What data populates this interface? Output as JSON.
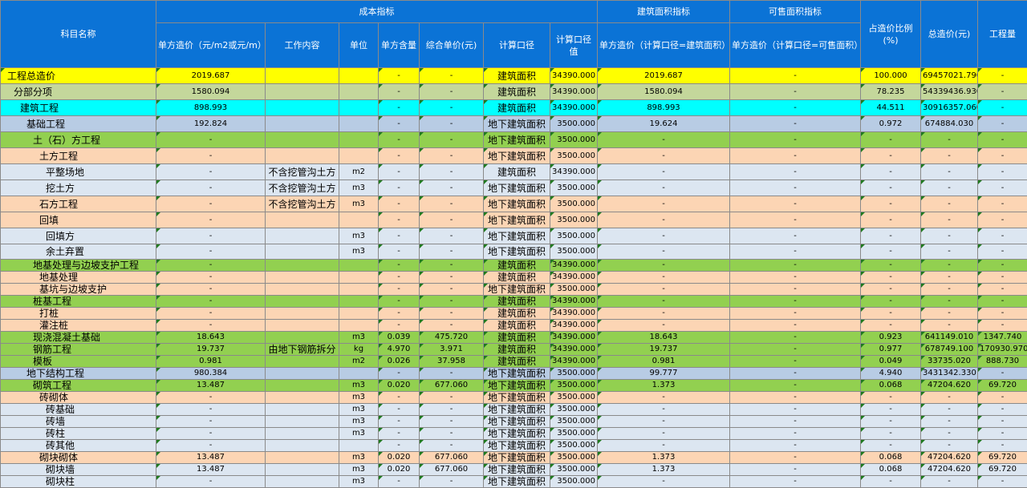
{
  "header": {
    "subject_name": "科目名称",
    "cost_indicator": "成本指标",
    "building_area_indicator": "建筑面积指标",
    "saleable_area_indicator": "可售面积指标",
    "cost_ratio": "占造价比例(%)",
    "total_cost": "总造价(元)",
    "quantity": "工程量",
    "unit_cost": "单方造价（元/m2或元/m）",
    "work_content": "工作内容",
    "unit": "单位",
    "unit_content": "单方含量",
    "composite_price": "综合单价(元)",
    "calc_basis": "计算口径",
    "calc_basis_value": "计算口径值",
    "unit_cost_building": "单方造价（计算口径=建筑面积）",
    "unit_cost_saleable": "单方造价（计算口径=可售面积）"
  },
  "colors": {
    "header_bg": "#0b73d6",
    "yellow": "#ffff00",
    "olive": "#c4d79b",
    "cyan": "#00ffff",
    "blue": "#b8cce4",
    "green": "#92d050",
    "peach": "#fcd5b4",
    "lavender": "#dce6f1"
  },
  "rows": [
    {
      "name": "工程总造价",
      "indent": 0,
      "color": "yellow",
      "h": 20,
      "unit_cost": "2019.687",
      "work": "",
      "unit": "",
      "content": "-",
      "price": "-",
      "basis": "建筑面积",
      "basis_val": "34390.000",
      "bldg": "2019.687",
      "sale": "-",
      "ratio": "100.000",
      "total": "69457021.790",
      "qty": "-"
    },
    {
      "name": "分部分项",
      "indent": 1,
      "color": "olive",
      "h": 20,
      "unit_cost": "1580.094",
      "work": "",
      "unit": "",
      "content": "-",
      "price": "-",
      "basis": "建筑面积",
      "basis_val": "34390.000",
      "bldg": "1580.094",
      "sale": "-",
      "ratio": "78.235",
      "total": "54339436.930",
      "qty": "-"
    },
    {
      "name": "建筑工程",
      "indent": 2,
      "color": "cyan",
      "h": 20,
      "unit_cost": "898.993",
      "work": "",
      "unit": "",
      "content": "-",
      "price": "-",
      "basis": "建筑面积",
      "basis_val": "34390.000",
      "bldg": "898.993",
      "sale": "-",
      "ratio": "44.511",
      "total": "30916357.060",
      "qty": "-"
    },
    {
      "name": "基础工程",
      "indent": 3,
      "color": "blue",
      "h": 20,
      "unit_cost": "192.824",
      "work": "",
      "unit": "",
      "content": "-",
      "price": "-",
      "basis": "地下建筑面积",
      "basis_val": "3500.000",
      "bldg": "19.624",
      "sale": "-",
      "ratio": "0.972",
      "total": "674884.030",
      "qty": "-"
    },
    {
      "name": "土（石）方工程",
      "indent": 4,
      "color": "green",
      "h": 20,
      "unit_cost": "-",
      "work": "",
      "unit": "",
      "content": "-",
      "price": "-",
      "basis": "地下建筑面积",
      "basis_val": "3500.000",
      "bldg": "-",
      "sale": "-",
      "ratio": "-",
      "total": "-",
      "qty": "-"
    },
    {
      "name": "土方工程",
      "indent": 5,
      "color": "peach",
      "h": 20,
      "unit_cost": "-",
      "work": "",
      "unit": "",
      "content": "-",
      "price": "-",
      "basis": "地下建筑面积",
      "basis_val": "3500.000",
      "bldg": "-",
      "sale": "-",
      "ratio": "-",
      "total": "-",
      "qty": "-"
    },
    {
      "name": "平整场地",
      "indent": 6,
      "color": "lav",
      "h": 20,
      "unit_cost": "-",
      "work": "不含挖管沟土方",
      "unit": "m2",
      "content": "-",
      "price": "-",
      "basis": "建筑面积",
      "basis_val": "34390.000",
      "bldg": "-",
      "sale": "-",
      "ratio": "-",
      "total": "-",
      "qty": "-"
    },
    {
      "name": "挖土方",
      "indent": 6,
      "color": "lav",
      "h": 20,
      "unit_cost": "-",
      "work": "不含挖管沟土方",
      "unit": "m3",
      "content": "-",
      "price": "-",
      "basis": "地下建筑面积",
      "basis_val": "3500.000",
      "bldg": "-",
      "sale": "-",
      "ratio": "-",
      "total": "-",
      "qty": "-"
    },
    {
      "name": "石方工程",
      "indent": 5,
      "color": "peach",
      "h": 20,
      "unit_cost": "-",
      "work": "不含挖管沟土方",
      "unit": "m3",
      "content": "-",
      "price": "-",
      "basis": "地下建筑面积",
      "basis_val": "3500.000",
      "bldg": "-",
      "sale": "-",
      "ratio": "-",
      "total": "-",
      "qty": "-"
    },
    {
      "name": "回填",
      "indent": 5,
      "color": "peach",
      "h": 20,
      "unit_cost": "-",
      "work": "",
      "unit": "",
      "content": "-",
      "price": "-",
      "basis": "地下建筑面积",
      "basis_val": "3500.000",
      "bldg": "-",
      "sale": "-",
      "ratio": "-",
      "total": "-",
      "qty": "-"
    },
    {
      "name": "回填方",
      "indent": 6,
      "color": "lav",
      "h": 20,
      "unit_cost": "-",
      "work": "",
      "unit": "m3",
      "content": "-",
      "price": "-",
      "basis": "地下建筑面积",
      "basis_val": "3500.000",
      "bldg": "-",
      "sale": "-",
      "ratio": "-",
      "total": "-",
      "qty": "-"
    },
    {
      "name": "余土弃置",
      "indent": 6,
      "color": "lav",
      "h": 19,
      "unit_cost": "-",
      "work": "",
      "unit": "m3",
      "content": "-",
      "price": "-",
      "basis": "地下建筑面积",
      "basis_val": "3500.000",
      "bldg": "-",
      "sale": "-",
      "ratio": "-",
      "total": "-",
      "qty": "-"
    },
    {
      "name": "地基处理与边坡支护工程",
      "indent": 4,
      "color": "green",
      "h": 15,
      "unit_cost": "-",
      "work": "",
      "unit": "",
      "content": "-",
      "price": "-",
      "basis": "建筑面积",
      "basis_val": "34390.000",
      "bldg": "-",
      "sale": "-",
      "ratio": "-",
      "total": "-",
      "qty": "-"
    },
    {
      "name": "地基处理",
      "indent": 5,
      "color": "peach",
      "h": 15,
      "unit_cost": "-",
      "work": "",
      "unit": "",
      "content": "-",
      "price": "-",
      "basis": "建筑面积",
      "basis_val": "34390.000",
      "bldg": "-",
      "sale": "-",
      "ratio": "-",
      "total": "-",
      "qty": "-"
    },
    {
      "name": "基坑与边坡支护",
      "indent": 5,
      "color": "peach",
      "h": 15,
      "unit_cost": "-",
      "work": "",
      "unit": "",
      "content": "-",
      "price": "-",
      "basis": "地下建筑面积",
      "basis_val": "3500.000",
      "bldg": "-",
      "sale": "-",
      "ratio": "-",
      "total": "-",
      "qty": "-"
    },
    {
      "name": "桩基工程",
      "indent": 4,
      "color": "green",
      "h": 15,
      "unit_cost": "-",
      "work": "",
      "unit": "",
      "content": "-",
      "price": "-",
      "basis": "建筑面积",
      "basis_val": "34390.000",
      "bldg": "-",
      "sale": "-",
      "ratio": "-",
      "total": "-",
      "qty": "-"
    },
    {
      "name": "打桩",
      "indent": 5,
      "color": "peach",
      "h": 15,
      "unit_cost": "-",
      "work": "",
      "unit": "",
      "content": "-",
      "price": "-",
      "basis": "建筑面积",
      "basis_val": "34390.000",
      "bldg": "-",
      "sale": "-",
      "ratio": "-",
      "total": "-",
      "qty": "-"
    },
    {
      "name": "灌注桩",
      "indent": 5,
      "color": "peach",
      "h": 15,
      "unit_cost": "-",
      "work": "",
      "unit": "",
      "content": "-",
      "price": "-",
      "basis": "建筑面积",
      "basis_val": "34390.000",
      "bldg": "-",
      "sale": "-",
      "ratio": "-",
      "total": "-",
      "qty": "-"
    },
    {
      "name": "现浇混凝土基础",
      "indent": 4,
      "color": "green",
      "h": 15,
      "unit_cost": "18.643",
      "work": "",
      "unit": "m3",
      "content": "0.039",
      "price": "475.720",
      "basis": "建筑面积",
      "basis_val": "34390.000",
      "bldg": "18.643",
      "sale": "-",
      "ratio": "0.923",
      "total": "641149.010",
      "qty": "1347.740"
    },
    {
      "name": "钢筋工程",
      "indent": 4,
      "color": "green",
      "h": 15,
      "unit_cost": "19.737",
      "work": "由地下钢筋拆分",
      "unit": "kg",
      "content": "4.970",
      "price": "3.971",
      "basis": "建筑面积",
      "basis_val": "34390.000",
      "bldg": "19.737",
      "sale": "-",
      "ratio": "0.977",
      "total": "678749.100",
      "qty": "170930.970"
    },
    {
      "name": "模板",
      "indent": 4,
      "color": "green",
      "h": 15,
      "unit_cost": "0.981",
      "work": "",
      "unit": "m2",
      "content": "0.026",
      "price": "37.958",
      "basis": "建筑面积",
      "basis_val": "34390.000",
      "bldg": "0.981",
      "sale": "-",
      "ratio": "0.049",
      "total": "33735.020",
      "qty": "888.730"
    },
    {
      "name": "地下结构工程",
      "indent": 3,
      "color": "blue",
      "h": 15,
      "unit_cost": "980.384",
      "work": "",
      "unit": "",
      "content": "-",
      "price": "-",
      "basis": "地下建筑面积",
      "basis_val": "3500.000",
      "bldg": "99.777",
      "sale": "-",
      "ratio": "4.940",
      "total": "3431342.330",
      "qty": "-"
    },
    {
      "name": "砌筑工程",
      "indent": 4,
      "color": "green",
      "h": 15,
      "unit_cost": "13.487",
      "work": "",
      "unit": "m3",
      "content": "0.020",
      "price": "677.060",
      "basis": "地下建筑面积",
      "basis_val": "3500.000",
      "bldg": "1.373",
      "sale": "-",
      "ratio": "0.068",
      "total": "47204.620",
      "qty": "69.720"
    },
    {
      "name": "砖砌体",
      "indent": 5,
      "color": "peach",
      "h": 15,
      "unit_cost": "-",
      "work": "",
      "unit": "m3",
      "content": "-",
      "price": "-",
      "basis": "地下建筑面积",
      "basis_val": "3500.000",
      "bldg": "-",
      "sale": "-",
      "ratio": "-",
      "total": "-",
      "qty": "-"
    },
    {
      "name": "砖基础",
      "indent": 6,
      "color": "lav",
      "h": 15,
      "unit_cost": "-",
      "work": "",
      "unit": "m3",
      "content": "-",
      "price": "-",
      "basis": "地下建筑面积",
      "basis_val": "3500.000",
      "bldg": "-",
      "sale": "-",
      "ratio": "-",
      "total": "-",
      "qty": "-"
    },
    {
      "name": "砖墙",
      "indent": 6,
      "color": "lav",
      "h": 15,
      "unit_cost": "-",
      "work": "",
      "unit": "m3",
      "content": "-",
      "price": "-",
      "basis": "地下建筑面积",
      "basis_val": "3500.000",
      "bldg": "-",
      "sale": "-",
      "ratio": "-",
      "total": "-",
      "qty": "-"
    },
    {
      "name": "砖柱",
      "indent": 6,
      "color": "lav",
      "h": 15,
      "unit_cost": "-",
      "work": "",
      "unit": "m3",
      "content": "-",
      "price": "-",
      "basis": "地下建筑面积",
      "basis_val": "3500.000",
      "bldg": "-",
      "sale": "-",
      "ratio": "-",
      "total": "-",
      "qty": "-"
    },
    {
      "name": "砖其他",
      "indent": 6,
      "color": "lav",
      "h": 15,
      "unit_cost": "-",
      "work": "",
      "unit": "",
      "content": "-",
      "price": "-",
      "basis": "地下建筑面积",
      "basis_val": "3500.000",
      "bldg": "-",
      "sale": "-",
      "ratio": "-",
      "total": "-",
      "qty": "-"
    },
    {
      "name": "砌块砌体",
      "indent": 5,
      "color": "peach",
      "h": 15,
      "unit_cost": "13.487",
      "work": "",
      "unit": "m3",
      "content": "0.020",
      "price": "677.060",
      "basis": "地下建筑面积",
      "basis_val": "3500.000",
      "bldg": "1.373",
      "sale": "-",
      "ratio": "0.068",
      "total": "47204.620",
      "qty": "69.720"
    },
    {
      "name": "砌块墙",
      "indent": 6,
      "color": "lav",
      "h": 15,
      "unit_cost": "13.487",
      "work": "",
      "unit": "m3",
      "content": "0.020",
      "price": "677.060",
      "basis": "地下建筑面积",
      "basis_val": "3500.000",
      "bldg": "1.373",
      "sale": "-",
      "ratio": "0.068",
      "total": "47204.620",
      "qty": "69.720"
    },
    {
      "name": "砌块柱",
      "indent": 6,
      "color": "lav",
      "h": 15,
      "unit_cost": "-",
      "work": "",
      "unit": "m3",
      "content": "-",
      "price": "-",
      "basis": "地下建筑面积",
      "basis_val": "3500.000",
      "bldg": "-",
      "sale": "-",
      "ratio": "-",
      "total": "-",
      "qty": "-"
    }
  ]
}
